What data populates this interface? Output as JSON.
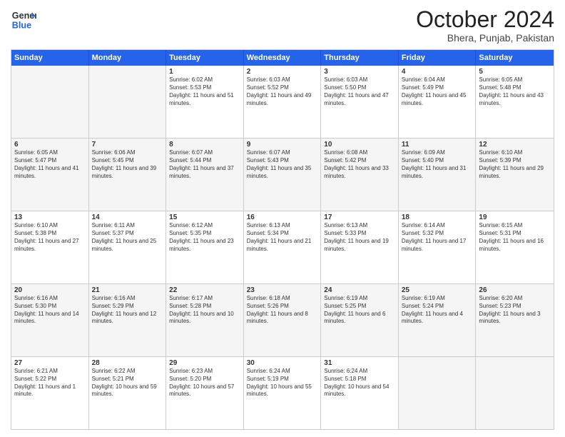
{
  "header": {
    "logo_line1": "General",
    "logo_line2": "Blue",
    "month": "October 2024",
    "location": "Bhera, Punjab, Pakistan"
  },
  "days_of_week": [
    "Sunday",
    "Monday",
    "Tuesday",
    "Wednesday",
    "Thursday",
    "Friday",
    "Saturday"
  ],
  "weeks": [
    [
      {
        "day": "",
        "info": ""
      },
      {
        "day": "",
        "info": ""
      },
      {
        "day": "1",
        "info": "Sunrise: 6:02 AM\nSunset: 5:53 PM\nDaylight: 11 hours and 51 minutes."
      },
      {
        "day": "2",
        "info": "Sunrise: 6:03 AM\nSunset: 5:52 PM\nDaylight: 11 hours and 49 minutes."
      },
      {
        "day": "3",
        "info": "Sunrise: 6:03 AM\nSunset: 5:50 PM\nDaylight: 11 hours and 47 minutes."
      },
      {
        "day": "4",
        "info": "Sunrise: 6:04 AM\nSunset: 5:49 PM\nDaylight: 11 hours and 45 minutes."
      },
      {
        "day": "5",
        "info": "Sunrise: 6:05 AM\nSunset: 5:48 PM\nDaylight: 11 hours and 43 minutes."
      }
    ],
    [
      {
        "day": "6",
        "info": "Sunrise: 6:05 AM\nSunset: 5:47 PM\nDaylight: 11 hours and 41 minutes."
      },
      {
        "day": "7",
        "info": "Sunrise: 6:06 AM\nSunset: 5:45 PM\nDaylight: 11 hours and 39 minutes."
      },
      {
        "day": "8",
        "info": "Sunrise: 6:07 AM\nSunset: 5:44 PM\nDaylight: 11 hours and 37 minutes."
      },
      {
        "day": "9",
        "info": "Sunrise: 6:07 AM\nSunset: 5:43 PM\nDaylight: 11 hours and 35 minutes."
      },
      {
        "day": "10",
        "info": "Sunrise: 6:08 AM\nSunset: 5:42 PM\nDaylight: 11 hours and 33 minutes."
      },
      {
        "day": "11",
        "info": "Sunrise: 6:09 AM\nSunset: 5:40 PM\nDaylight: 11 hours and 31 minutes."
      },
      {
        "day": "12",
        "info": "Sunrise: 6:10 AM\nSunset: 5:39 PM\nDaylight: 11 hours and 29 minutes."
      }
    ],
    [
      {
        "day": "13",
        "info": "Sunrise: 6:10 AM\nSunset: 5:38 PM\nDaylight: 11 hours and 27 minutes."
      },
      {
        "day": "14",
        "info": "Sunrise: 6:11 AM\nSunset: 5:37 PM\nDaylight: 11 hours and 25 minutes."
      },
      {
        "day": "15",
        "info": "Sunrise: 6:12 AM\nSunset: 5:35 PM\nDaylight: 11 hours and 23 minutes."
      },
      {
        "day": "16",
        "info": "Sunrise: 6:13 AM\nSunset: 5:34 PM\nDaylight: 11 hours and 21 minutes."
      },
      {
        "day": "17",
        "info": "Sunrise: 6:13 AM\nSunset: 5:33 PM\nDaylight: 11 hours and 19 minutes."
      },
      {
        "day": "18",
        "info": "Sunrise: 6:14 AM\nSunset: 5:32 PM\nDaylight: 11 hours and 17 minutes."
      },
      {
        "day": "19",
        "info": "Sunrise: 6:15 AM\nSunset: 5:31 PM\nDaylight: 11 hours and 16 minutes."
      }
    ],
    [
      {
        "day": "20",
        "info": "Sunrise: 6:16 AM\nSunset: 5:30 PM\nDaylight: 11 hours and 14 minutes."
      },
      {
        "day": "21",
        "info": "Sunrise: 6:16 AM\nSunset: 5:29 PM\nDaylight: 11 hours and 12 minutes."
      },
      {
        "day": "22",
        "info": "Sunrise: 6:17 AM\nSunset: 5:28 PM\nDaylight: 11 hours and 10 minutes."
      },
      {
        "day": "23",
        "info": "Sunrise: 6:18 AM\nSunset: 5:26 PM\nDaylight: 11 hours and 8 minutes."
      },
      {
        "day": "24",
        "info": "Sunrise: 6:19 AM\nSunset: 5:25 PM\nDaylight: 11 hours and 6 minutes."
      },
      {
        "day": "25",
        "info": "Sunrise: 6:19 AM\nSunset: 5:24 PM\nDaylight: 11 hours and 4 minutes."
      },
      {
        "day": "26",
        "info": "Sunrise: 6:20 AM\nSunset: 5:23 PM\nDaylight: 11 hours and 3 minutes."
      }
    ],
    [
      {
        "day": "27",
        "info": "Sunrise: 6:21 AM\nSunset: 5:22 PM\nDaylight: 11 hours and 1 minute."
      },
      {
        "day": "28",
        "info": "Sunrise: 6:22 AM\nSunset: 5:21 PM\nDaylight: 10 hours and 59 minutes."
      },
      {
        "day": "29",
        "info": "Sunrise: 6:23 AM\nSunset: 5:20 PM\nDaylight: 10 hours and 57 minutes."
      },
      {
        "day": "30",
        "info": "Sunrise: 6:24 AM\nSunset: 5:19 PM\nDaylight: 10 hours and 55 minutes."
      },
      {
        "day": "31",
        "info": "Sunrise: 6:24 AM\nSunset: 5:18 PM\nDaylight: 10 hours and 54 minutes."
      },
      {
        "day": "",
        "info": ""
      },
      {
        "day": "",
        "info": ""
      }
    ]
  ]
}
